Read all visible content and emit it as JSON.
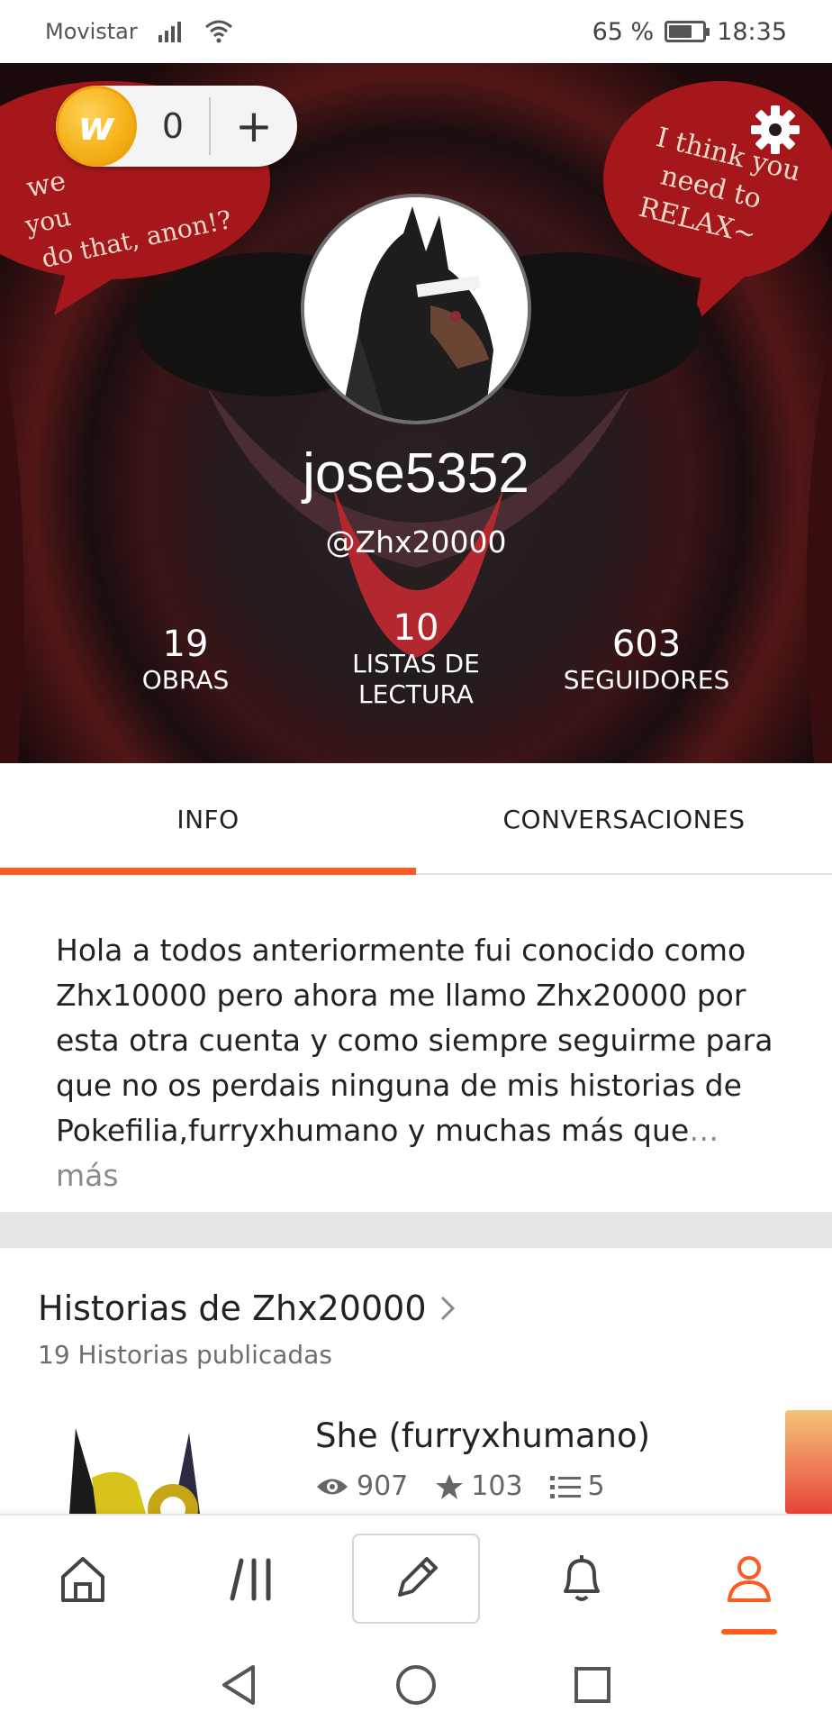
{
  "status_bar": {
    "carrier": "Movistar",
    "battery_percent": "65 %",
    "battery_level": 0.65,
    "time": "18:35"
  },
  "header": {
    "coins": {
      "count": "0",
      "add_label": "+"
    },
    "username": "jose5352",
    "handle": "@Zhx20000",
    "stats": [
      {
        "value": "19",
        "label": "OBRAS"
      },
      {
        "value": "10",
        "label": "LISTAS DE LECTURA"
      },
      {
        "value": "603",
        "label": "SEGUIDORES"
      }
    ]
  },
  "tabs": [
    {
      "label": "INFO",
      "active": true
    },
    {
      "label": "CONVERSACIONES",
      "active": false
    }
  ],
  "bio": {
    "text": "Hola a todos anteriormente fui conocido como Zhx10000 pero ahora me llamo Zhx20000 por esta otra cuenta y como siempre seguirme para que no os perdais ninguna de mis historias de Pokefilia,furryxhumano y muchas más que",
    "more_label": "… más"
  },
  "stories": {
    "title": "Historias de Zhx20000",
    "subtitle": "19 Historias publicadas",
    "items": [
      {
        "title": "She (furryxhumano)",
        "reads": "907",
        "votes": "103",
        "parts": "5"
      }
    ]
  },
  "bottom_nav": {
    "items": [
      "home-icon",
      "library-icon",
      "write-icon",
      "notifications-icon",
      "profile-icon"
    ],
    "active": "profile-icon"
  },
  "colors": {
    "accent": "#ff5a1f",
    "coin": "#f6b21b"
  }
}
